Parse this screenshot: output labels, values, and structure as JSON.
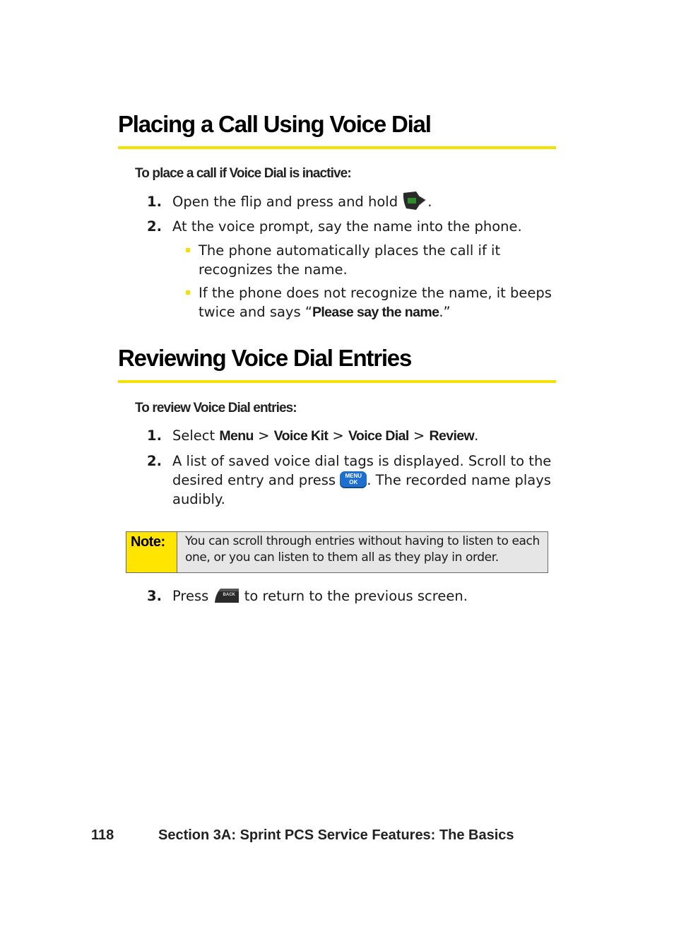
{
  "section1": {
    "heading": "Placing a Call Using Voice Dial",
    "subheading": "To place a call if Voice Dial is inactive:",
    "steps": [
      {
        "num": "1.",
        "text_before": "Open the flip and press and hold ",
        "icon": "talk-key-icon",
        "text_after": "."
      },
      {
        "num": "2.",
        "text": "At the voice prompt, say the name into the phone."
      }
    ],
    "bullets": [
      {
        "line1": "The phone automatically places the call if it",
        "line2": "recognizes the name."
      },
      {
        "line1": "If the phone does not recognize the name, it beeps",
        "line2_before": "twice and says “",
        "line2_bold": "Please say the name",
        "line2_after": ".”"
      }
    ]
  },
  "section2": {
    "heading": "Reviewing Voice Dial Entries",
    "subheading": "To review Voice Dial entries:",
    "step1": {
      "num": "1.",
      "select": "Select ",
      "menu": "Menu",
      "sep": " > ",
      "voicekit": "Voice Kit",
      "voicedial": "Voice Dial",
      "review": "Review",
      "end": "."
    },
    "step2": {
      "num": "2.",
      "line1": "A list of saved voice dial tags is displayed. Scroll to the",
      "line2_before": "desired entry and press ",
      "icon": "menu-ok-key-icon",
      "line2_after": ". The recorded name plays",
      "line3": "audibly."
    },
    "note": {
      "label": "Note:",
      "text": "You can scroll through entries without having to listen to each one, or you can listen to them all as they play in order."
    },
    "step3": {
      "num": "3.",
      "before": "Press ",
      "icon": "back-key-icon",
      "after": " to return to the previous screen."
    },
    "menu_key": {
      "line1": "MENU",
      "line2": "OK"
    },
    "back_key": {
      "label": "BACK"
    }
  },
  "footer": {
    "page_number": "118",
    "section_title": "Section 3A: Sprint PCS Service Features: The Basics"
  },
  "colors": {
    "accent": "#f5e100",
    "note_bg": "#e6e6e6",
    "note_label_bg": "#ffe500"
  }
}
